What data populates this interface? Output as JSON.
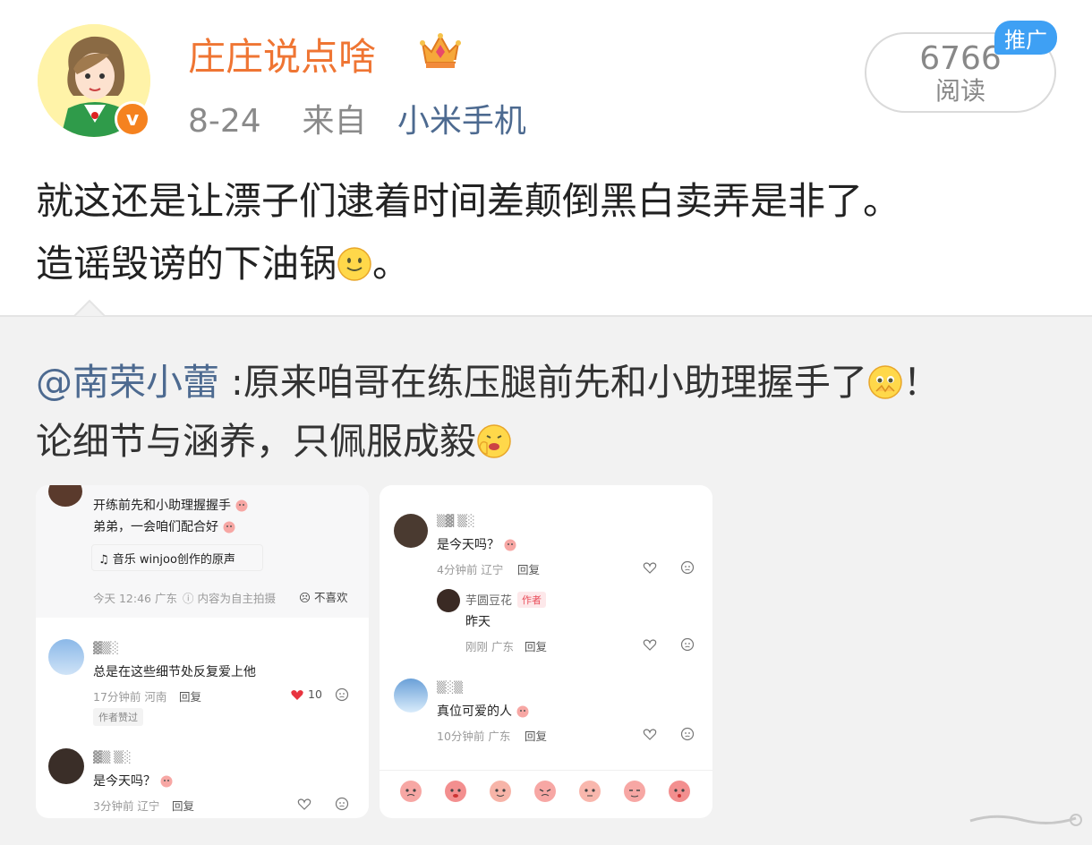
{
  "post": {
    "author": "庄庄说点啥",
    "date": "8-24",
    "from_label": "来自",
    "source": "小米手机",
    "reads_count": "6766",
    "reads_label": "阅读",
    "promo_badge": "推广",
    "text_line1": "就这还是让漂子们逮着时间差颠倒黑白卖弄是非了。",
    "text_line2_a": "造谣毁谤的下油锅",
    "text_line2_b": "。"
  },
  "repost": {
    "mention": "@南荣小蕾",
    "text_line1": " :原来咱哥在练压腿前先和小助理握手了",
    "text_line1_end": "！",
    "text_line2": "论细节与涵养，只佩服成毅"
  },
  "screenshot_left": {
    "caption_line1": "开练前先和小助理握握手",
    "caption_line2": "弟弟，一会咱们配合好",
    "music": "音乐  winjoo创作的原声",
    "post_time": "今天 12:46 广东",
    "self_shot": "内容为自主拍摄",
    "dislike": "不喜欢",
    "c1_text": "总是在这些细节处反复爱上他",
    "c1_meta": "17分钟前 河南",
    "reply": "回复",
    "c1_likes": "10",
    "author_liked": "作者赞过",
    "c2_text": "是今天吗？",
    "c2_meta": "3分钟前 辽宁"
  },
  "screenshot_right": {
    "c1_text": "是今天吗？",
    "c1_meta": "4分钟前 辽宁",
    "reply": "回复",
    "r1_name": "芋圆豆花",
    "author_tag": "作者",
    "r1_text": "昨天",
    "r1_meta": "刚刚 广东",
    "c2_text": "真位可爱的人",
    "c2_meta": "10分钟前 广东"
  },
  "colors": {
    "username": "#ef7533",
    "link": "#4d6a90",
    "promo": "#3ea0f4",
    "verified": "#f5821f",
    "heart": "#e8343f"
  }
}
